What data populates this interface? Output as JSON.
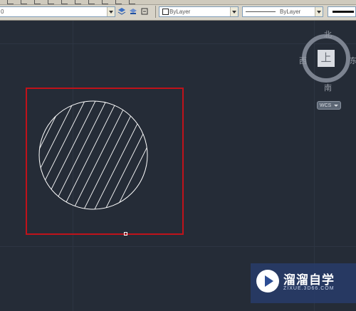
{
  "toolbar": {
    "layer_value": "0",
    "color_value": "ByLayer",
    "linetype_value": "ByLayer",
    "lineweight_value": ""
  },
  "viewcube": {
    "north": "北",
    "south": "南",
    "west": "西",
    "east": "东",
    "face": "上",
    "wcs": "WCS"
  },
  "watermark": {
    "title": "溜溜自学",
    "subtitle": "ZIXUE.3D66.COM"
  },
  "colors": {
    "background": "#252c37",
    "selection_box": "#c0121a",
    "hatch": "#ffffff"
  },
  "icons": {
    "layer_toolbar": [
      "layer-states-icon",
      "make-current-icon",
      "layer-previous-icon"
    ],
    "viewcube_face": "viewcube-top-face",
    "watermark_logo": "play-icon"
  }
}
